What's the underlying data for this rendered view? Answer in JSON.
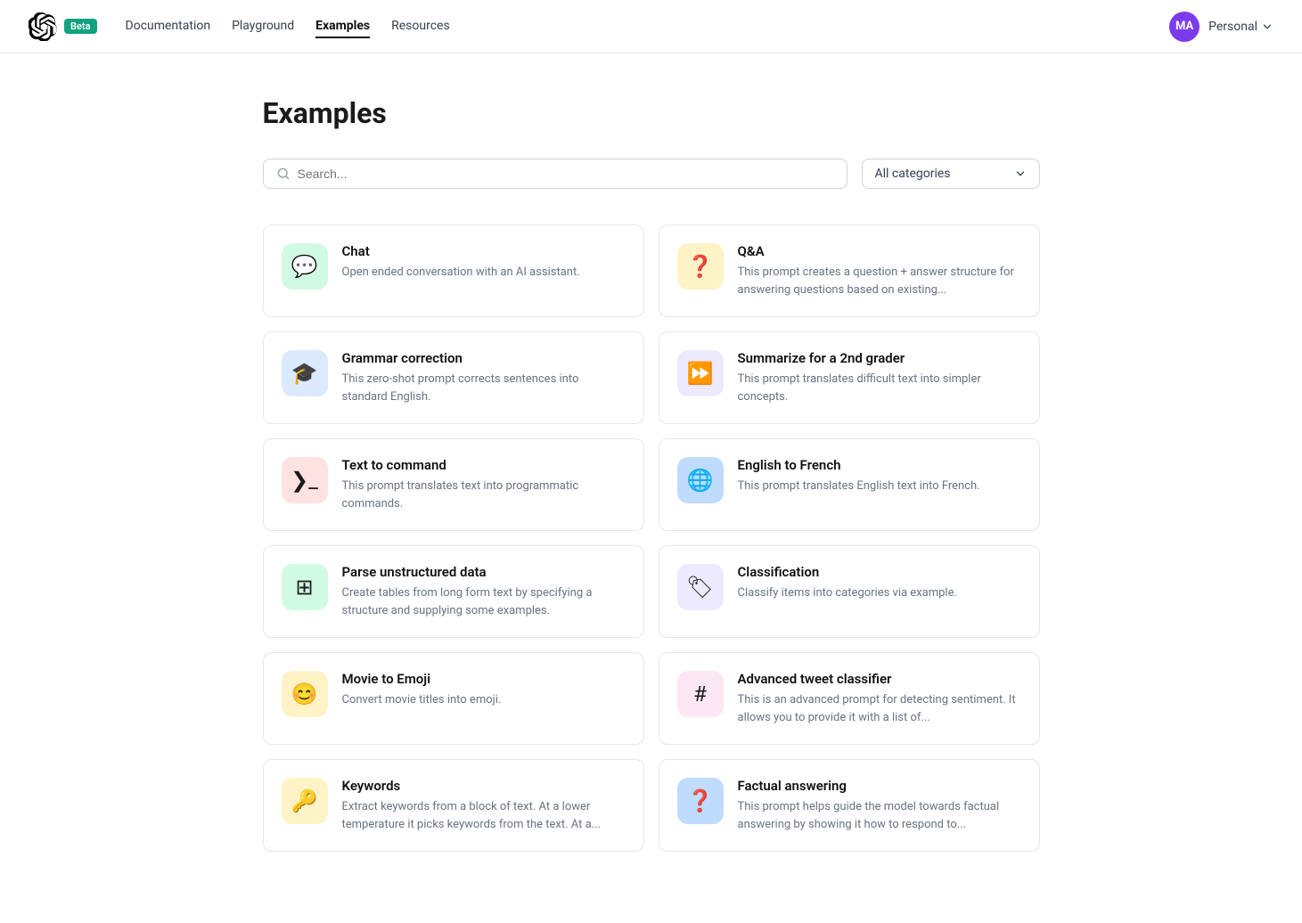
{
  "nav": {
    "logo_text": "OpenAI",
    "beta_label": "Beta",
    "links": [
      {
        "id": "documentation",
        "label": "Documentation",
        "active": false
      },
      {
        "id": "playground",
        "label": "Playground",
        "active": false
      },
      {
        "id": "examples",
        "label": "Examples",
        "active": true
      },
      {
        "id": "resources",
        "label": "Resources",
        "active": false
      }
    ],
    "user_initials": "MA",
    "user_label": "Personal"
  },
  "page": {
    "title": "Examples",
    "search_placeholder": "Search...",
    "category_label": "All categories"
  },
  "cards": [
    {
      "id": "chat",
      "title": "Chat",
      "desc": "Open ended conversation with an AI assistant.",
      "icon": "💬",
      "bg": "bg-green"
    },
    {
      "id": "qa",
      "title": "Q&A",
      "desc": "This prompt creates a question + answer structure for answering questions based on existing...",
      "icon": "❓",
      "bg": "bg-yellow"
    },
    {
      "id": "grammar",
      "title": "Grammar correction",
      "desc": "This zero-shot prompt corrects sentences into standard English.",
      "icon": "🎓",
      "bg": "bg-blue-lt"
    },
    {
      "id": "summarize",
      "title": "Summarize for a 2nd grader",
      "desc": "This prompt translates difficult text into simpler concepts.",
      "icon": "⏩",
      "bg": "bg-purple"
    },
    {
      "id": "text-command",
      "title": "Text to command",
      "desc": "This prompt translates text into programmatic commands.",
      "icon": "❯_",
      "bg": "bg-red"
    },
    {
      "id": "en-fr",
      "title": "English to French",
      "desc": "This prompt translates English text into French.",
      "icon": "🌐",
      "bg": "bg-blue2"
    },
    {
      "id": "parse",
      "title": "Parse unstructured data",
      "desc": "Create tables from long form text by specifying a structure and supplying some examples.",
      "icon": "⊞",
      "bg": "bg-green2"
    },
    {
      "id": "classification",
      "title": "Classification",
      "desc": "Classify items into categories via example.",
      "icon": "🏷",
      "bg": "bg-violet"
    },
    {
      "id": "movie-emoji",
      "title": "Movie to Emoji",
      "desc": "Convert movie titles into emoji.",
      "icon": "😊",
      "bg": "bg-amber"
    },
    {
      "id": "tweet-classifier",
      "title": "Advanced tweet classifier",
      "desc": "This is an advanced prompt for detecting sentiment. It allows you to provide it with a list of...",
      "icon": "#",
      "bg": "bg-pink"
    },
    {
      "id": "keywords",
      "title": "Keywords",
      "desc": "Extract keywords from a block of text. At a lower temperature it picks keywords from the text. At a...",
      "icon": "🔑",
      "bg": "bg-key"
    },
    {
      "id": "factual",
      "title": "Factual answering",
      "desc": "This prompt helps guide the model towards factual answering by showing it how to respond to...",
      "icon": "❓",
      "bg": "bg-factual"
    }
  ]
}
